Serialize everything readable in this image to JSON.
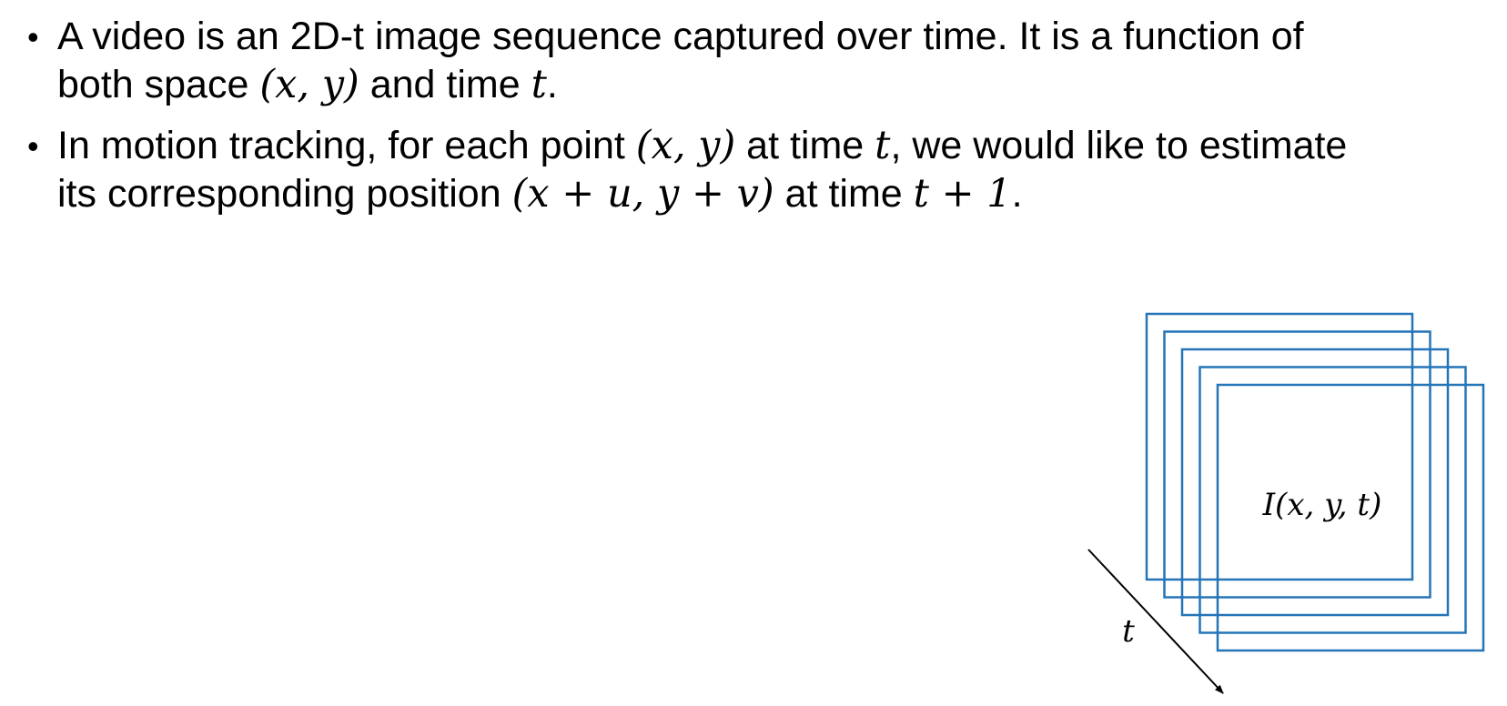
{
  "bullets": [
    {
      "line1": {
        "before": "A video is an 2D-t image sequence captured over time. It is a function of"
      },
      "line2": {
        "before": "both space ",
        "math1": "(x, y)",
        "middle": " and time ",
        "math2": "t",
        "after": "."
      }
    },
    {
      "line1": {
        "before": "In motion tracking, for each point ",
        "math1": "(x, y)",
        "middle": " at time ",
        "math2": "t",
        "after": ", we would like to estimate"
      },
      "line2": {
        "before": "its corresponding position ",
        "math1": "(x + u, y + v)",
        "middle": " at time ",
        "math2": "t + 1",
        "after": "."
      }
    }
  ],
  "diagram": {
    "frame_color": "#2475b8",
    "frame_count": 5,
    "frame_label": "I(x, y, t)",
    "axis_label": "t",
    "axis_color": "#000000"
  }
}
